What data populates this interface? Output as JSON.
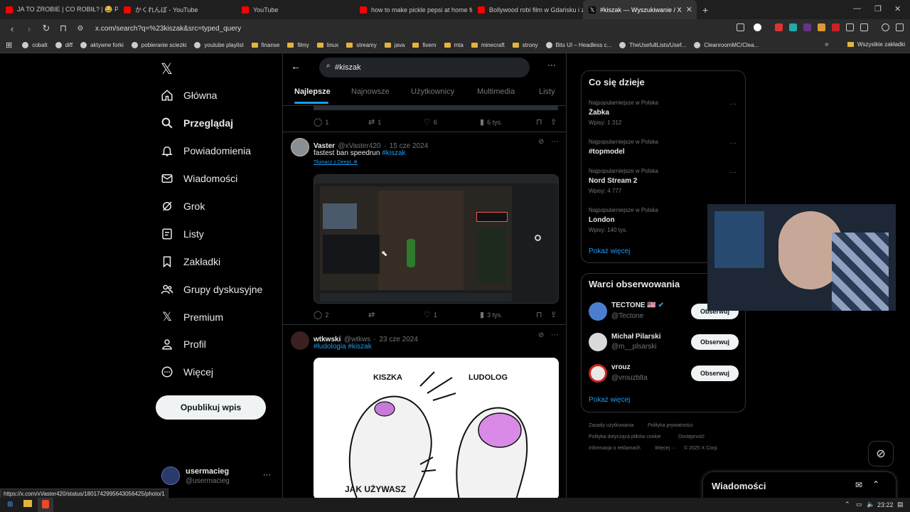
{
  "browser": {
    "tabs": [
      {
        "title": "JA TO ZROBIE | CO ROBIŁ? | 😂 POLSK",
        "color": "#ff0000"
      },
      {
        "title": "かくれんぼ - YouTube",
        "color": "#ff0000"
      },
      {
        "title": "YouTube",
        "color": "#ff0000"
      },
      {
        "title": "how to make pickle pepsi at home fr",
        "color": "#ff0000"
      },
      {
        "title": "Bollywood robi film w Gdańsku i za p",
        "color": "#ff0000"
      },
      {
        "title": "#kiszak — Wyszukiwanie / X",
        "color": "#ffffff"
      }
    ],
    "new_tab": "+",
    "url": "x.com/search?q=%23kiszak&src=typed_query",
    "bookmarks": [
      {
        "label": "cobalt",
        "kind": "site"
      },
      {
        "label": "diff",
        "kind": "site"
      },
      {
        "label": "aktywne forki",
        "kind": "site"
      },
      {
        "label": "pobieranie sciezki",
        "kind": "site"
      },
      {
        "label": "youtube playlist",
        "kind": "site"
      },
      {
        "label": "finanse",
        "kind": "folder"
      },
      {
        "label": "filmy",
        "kind": "folder"
      },
      {
        "label": "linux",
        "kind": "folder"
      },
      {
        "label": "streamy",
        "kind": "folder"
      },
      {
        "label": "java",
        "kind": "folder"
      },
      {
        "label": "fivem",
        "kind": "folder"
      },
      {
        "label": "mta",
        "kind": "folder"
      },
      {
        "label": "minecraft",
        "kind": "folder"
      },
      {
        "label": "strony",
        "kind": "folder"
      },
      {
        "label": "Bits UI – Headless c...",
        "kind": "site"
      },
      {
        "label": "TheUsefullLists/Usef...",
        "kind": "site"
      },
      {
        "label": "CleanroomMC/Clea...",
        "kind": "site"
      }
    ],
    "all_bookmarks": "Wszystkie zakładki",
    "status_url": "https://x.com/xVaster420/status/1801742995643056425/photo/1"
  },
  "nav": {
    "items": [
      {
        "label": "Główna",
        "icon": "home-icon"
      },
      {
        "label": "Przeglądaj",
        "icon": "search-icon"
      },
      {
        "label": "Powiadomienia",
        "icon": "bell-icon"
      },
      {
        "label": "Wiadomości",
        "icon": "mail-icon"
      },
      {
        "label": "Grok",
        "icon": "grok-icon"
      },
      {
        "label": "Listy",
        "icon": "list-icon"
      },
      {
        "label": "Zakładki",
        "icon": "bookmark-icon"
      },
      {
        "label": "Grupy dyskusyjne",
        "icon": "people-icon"
      },
      {
        "label": "Premium",
        "icon": "x-logo-icon"
      },
      {
        "label": "Profil",
        "icon": "person-icon"
      },
      {
        "label": "Więcej",
        "icon": "more-circle-icon"
      }
    ],
    "post_button": "Opublikuj wpis",
    "account": {
      "name": "usermacieg",
      "handle": "@usermacieg"
    }
  },
  "search": {
    "query": "#kiszak",
    "tabs": [
      "Najlepsze",
      "Najnowsze",
      "Użytkownicy",
      "Multimedia",
      "Listy"
    ]
  },
  "tweets": [
    {
      "stats": {
        "replies": "1",
        "reposts": "1",
        "likes": "6",
        "views": "6 tys."
      }
    },
    {
      "name": "Vaster",
      "handle": "@xVaster420",
      "date": "15 cze 2024",
      "text": "fastest ban speedrun",
      "hashtag": "#kiszak",
      "translate": "Tłumacz z DeepL",
      "stats": {
        "replies": "2",
        "reposts": "",
        "likes": "1",
        "views": "3 tys."
      }
    },
    {
      "name": "wtkwski",
      "handle": "@wtkws",
      "date": "23 cze 2024",
      "hashtags": "#ludologia",
      "hashtag2": "#kiszak",
      "meme": {
        "left": "KISZKA",
        "right": "LUDOLOG",
        "bottom": "JAK UŻYWASZ"
      }
    }
  ],
  "trends": {
    "title": "Co się dzieje",
    "items": [
      {
        "meta": "Najpopularniejsze w Polska",
        "name": "Żabka",
        "count": "Wpisy: 1 312"
      },
      {
        "meta": "Najpopularniejsze w Polska",
        "name": "#topmodel",
        "count": ""
      },
      {
        "meta": "Najpopularniejsze w Polska",
        "name": "Nord Stream 2",
        "count": "Wpisy: 4 777"
      },
      {
        "meta": "Najpopularniejsze w Polska",
        "name": "London",
        "count": "Wpisy: 140 tys."
      }
    ],
    "show_more": "Pokaż więcej"
  },
  "follow": {
    "title": "Warci obserwowania",
    "items": [
      {
        "name": "TECTONE 🇺🇸",
        "handle": "@Tectone",
        "button": "Obserwuj"
      },
      {
        "name": "Michał Pilarski",
        "handle": "@m__plsarski",
        "button": "Obserwuj"
      },
      {
        "name": "vrouz",
        "handle": "@vrouzblta",
        "button": "Obserwuj"
      }
    ],
    "show_more": "Pokaż więcej"
  },
  "footer": {
    "links": [
      "Zasady użytkowania",
      "Polityka prywatności",
      "Polityka dotycząca plików cookie",
      "Dostępność",
      "Informacja o reklamach",
      "Więcej ···",
      "© 2025 X Corp."
    ]
  },
  "messages_drawer": {
    "title": "Wiadomości"
  },
  "taskbar": {
    "time": "23:22"
  },
  "colors": {
    "accent": "#1d9bf0",
    "bg": "#000000",
    "border": "#2f3336"
  }
}
